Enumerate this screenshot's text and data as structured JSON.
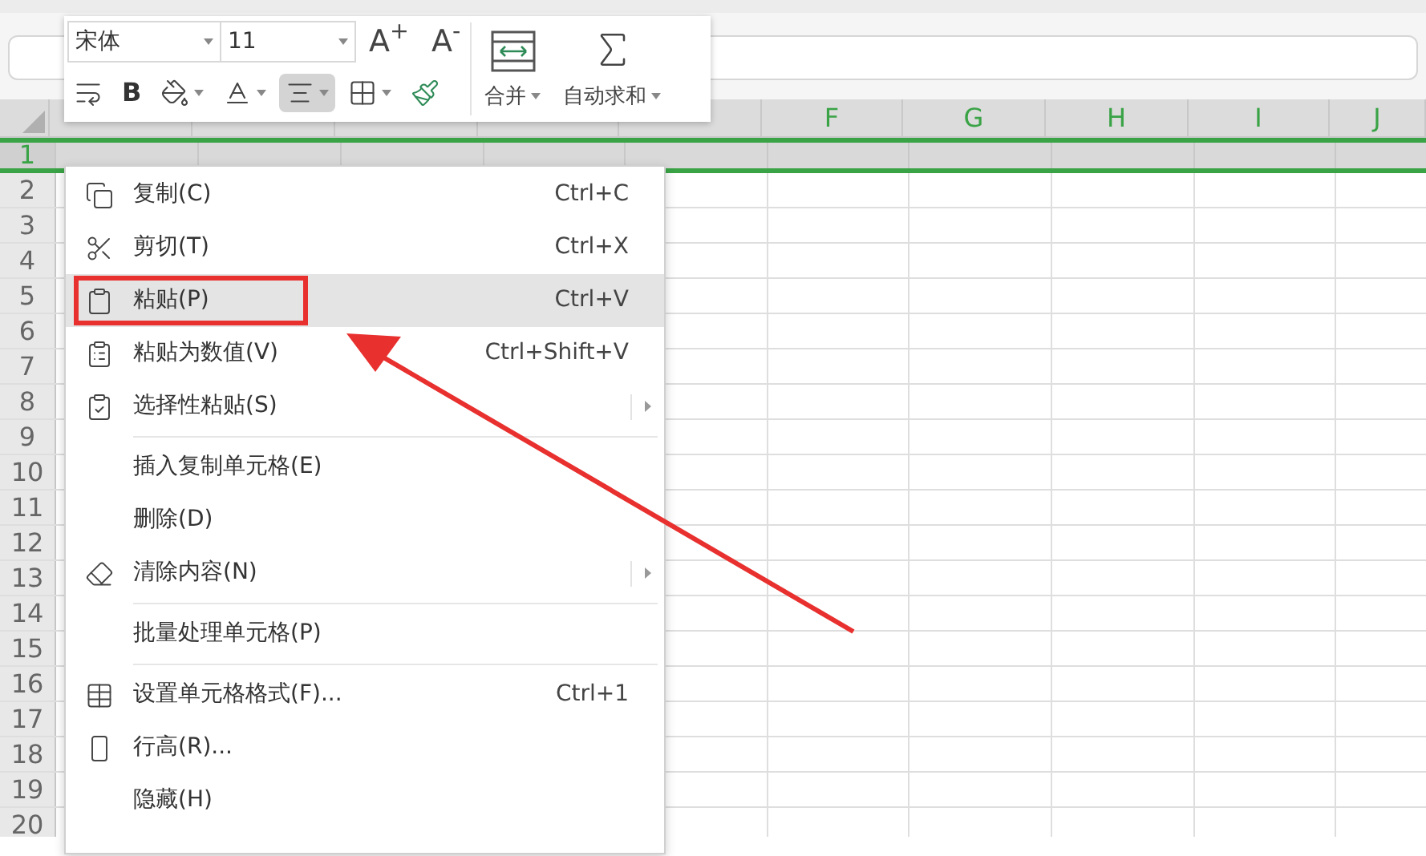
{
  "toolbar": {
    "font": "宋体",
    "size": "11",
    "grow_font": "A$^{+}$",
    "shrink_font": "A$^{-}$",
    "tools": [
      {
        "kind": "wrap",
        "selected": false
      },
      {
        "kind": "bold",
        "label": "B",
        "selected": false
      },
      {
        "kind": "fill",
        "selected": false
      },
      {
        "kind": "font_color",
        "selected": false
      },
      {
        "kind": "align",
        "selected": true
      },
      {
        "kind": "borders",
        "selected": false
      },
      {
        "kind": "painter",
        "selected": false
      }
    ],
    "merge": "合并",
    "autosum": "自动求和"
  },
  "sheet": {
    "columns": [
      {
        "kind": "blank"
      },
      {
        "kind": "blank"
      },
      {
        "kind": "blank"
      },
      {
        "kind": "blank"
      },
      {
        "kind": "blank"
      },
      {
        "kind": "label",
        "label": "F"
      },
      {
        "kind": "label",
        "label": "G"
      },
      {
        "kind": "label",
        "label": "H"
      },
      {
        "kind": "label",
        "label": "I"
      },
      {
        "kind": "label",
        "label": "J"
      }
    ],
    "rows": [
      {
        "label": "1",
        "selected": true
      },
      {
        "label": "2",
        "selected": false
      },
      {
        "label": "3",
        "selected": false
      },
      {
        "label": "4",
        "selected": false
      },
      {
        "label": "5",
        "selected": false
      },
      {
        "label": "6",
        "selected": false
      },
      {
        "label": "7",
        "selected": false
      },
      {
        "label": "8",
        "selected": false
      },
      {
        "label": "9",
        "selected": false
      },
      {
        "label": "10",
        "selected": false
      },
      {
        "label": "11",
        "selected": false
      },
      {
        "label": "12",
        "selected": false
      },
      {
        "label": "13",
        "selected": false
      },
      {
        "label": "14",
        "selected": false
      },
      {
        "label": "15",
        "selected": false
      },
      {
        "label": "16",
        "selected": false
      },
      {
        "label": "17",
        "selected": false
      },
      {
        "label": "18",
        "selected": false
      },
      {
        "label": "19",
        "selected": false
      },
      {
        "label": "20",
        "selected": false
      }
    ]
  },
  "context_menu": [
    {
      "kind": "item",
      "label": "复制(C)",
      "shortcut": "Ctrl+C",
      "hovered": false,
      "submenu": false,
      "annotated": false
    },
    {
      "kind": "item",
      "label": "剪切(T)",
      "shortcut": "Ctrl+X",
      "hovered": false,
      "submenu": false,
      "annotated": false
    },
    {
      "kind": "item",
      "label": "粘贴(P)",
      "shortcut": "Ctrl+V",
      "hovered": true,
      "submenu": false,
      "annotated": true
    },
    {
      "kind": "item",
      "label": "粘贴为数值(V)",
      "shortcut": "Ctrl+Shift+V",
      "hovered": false,
      "submenu": false,
      "annotated": false
    },
    {
      "kind": "item",
      "label": "选择性粘贴(S)",
      "hovered": false,
      "submenu": true,
      "annotated": false
    },
    {
      "kind": "separator"
    },
    {
      "kind": "item",
      "label": "插入复制单元格(E)",
      "hovered": false,
      "submenu": false,
      "annotated": false
    },
    {
      "kind": "item",
      "label": "删除(D)",
      "hovered": false,
      "submenu": false,
      "annotated": false
    },
    {
      "kind": "item",
      "label": "清除内容(N)",
      "hovered": false,
      "submenu": true,
      "annotated": false
    },
    {
      "kind": "separator"
    },
    {
      "kind": "item",
      "label": "批量处理单元格(P)",
      "hovered": false,
      "submenu": false,
      "annotated": false
    },
    {
      "kind": "separator"
    },
    {
      "kind": "item",
      "label": "设置单元格格式(F)...",
      "shortcut": "Ctrl+1",
      "hovered": false,
      "submenu": false,
      "annotated": false
    },
    {
      "kind": "item",
      "label": "行高(R)...",
      "hovered": false,
      "submenu": false,
      "annotated": false
    },
    {
      "kind": "item",
      "label": "隐藏(H)",
      "hovered": false,
      "submenu": false,
      "annotated": false
    }
  ]
}
